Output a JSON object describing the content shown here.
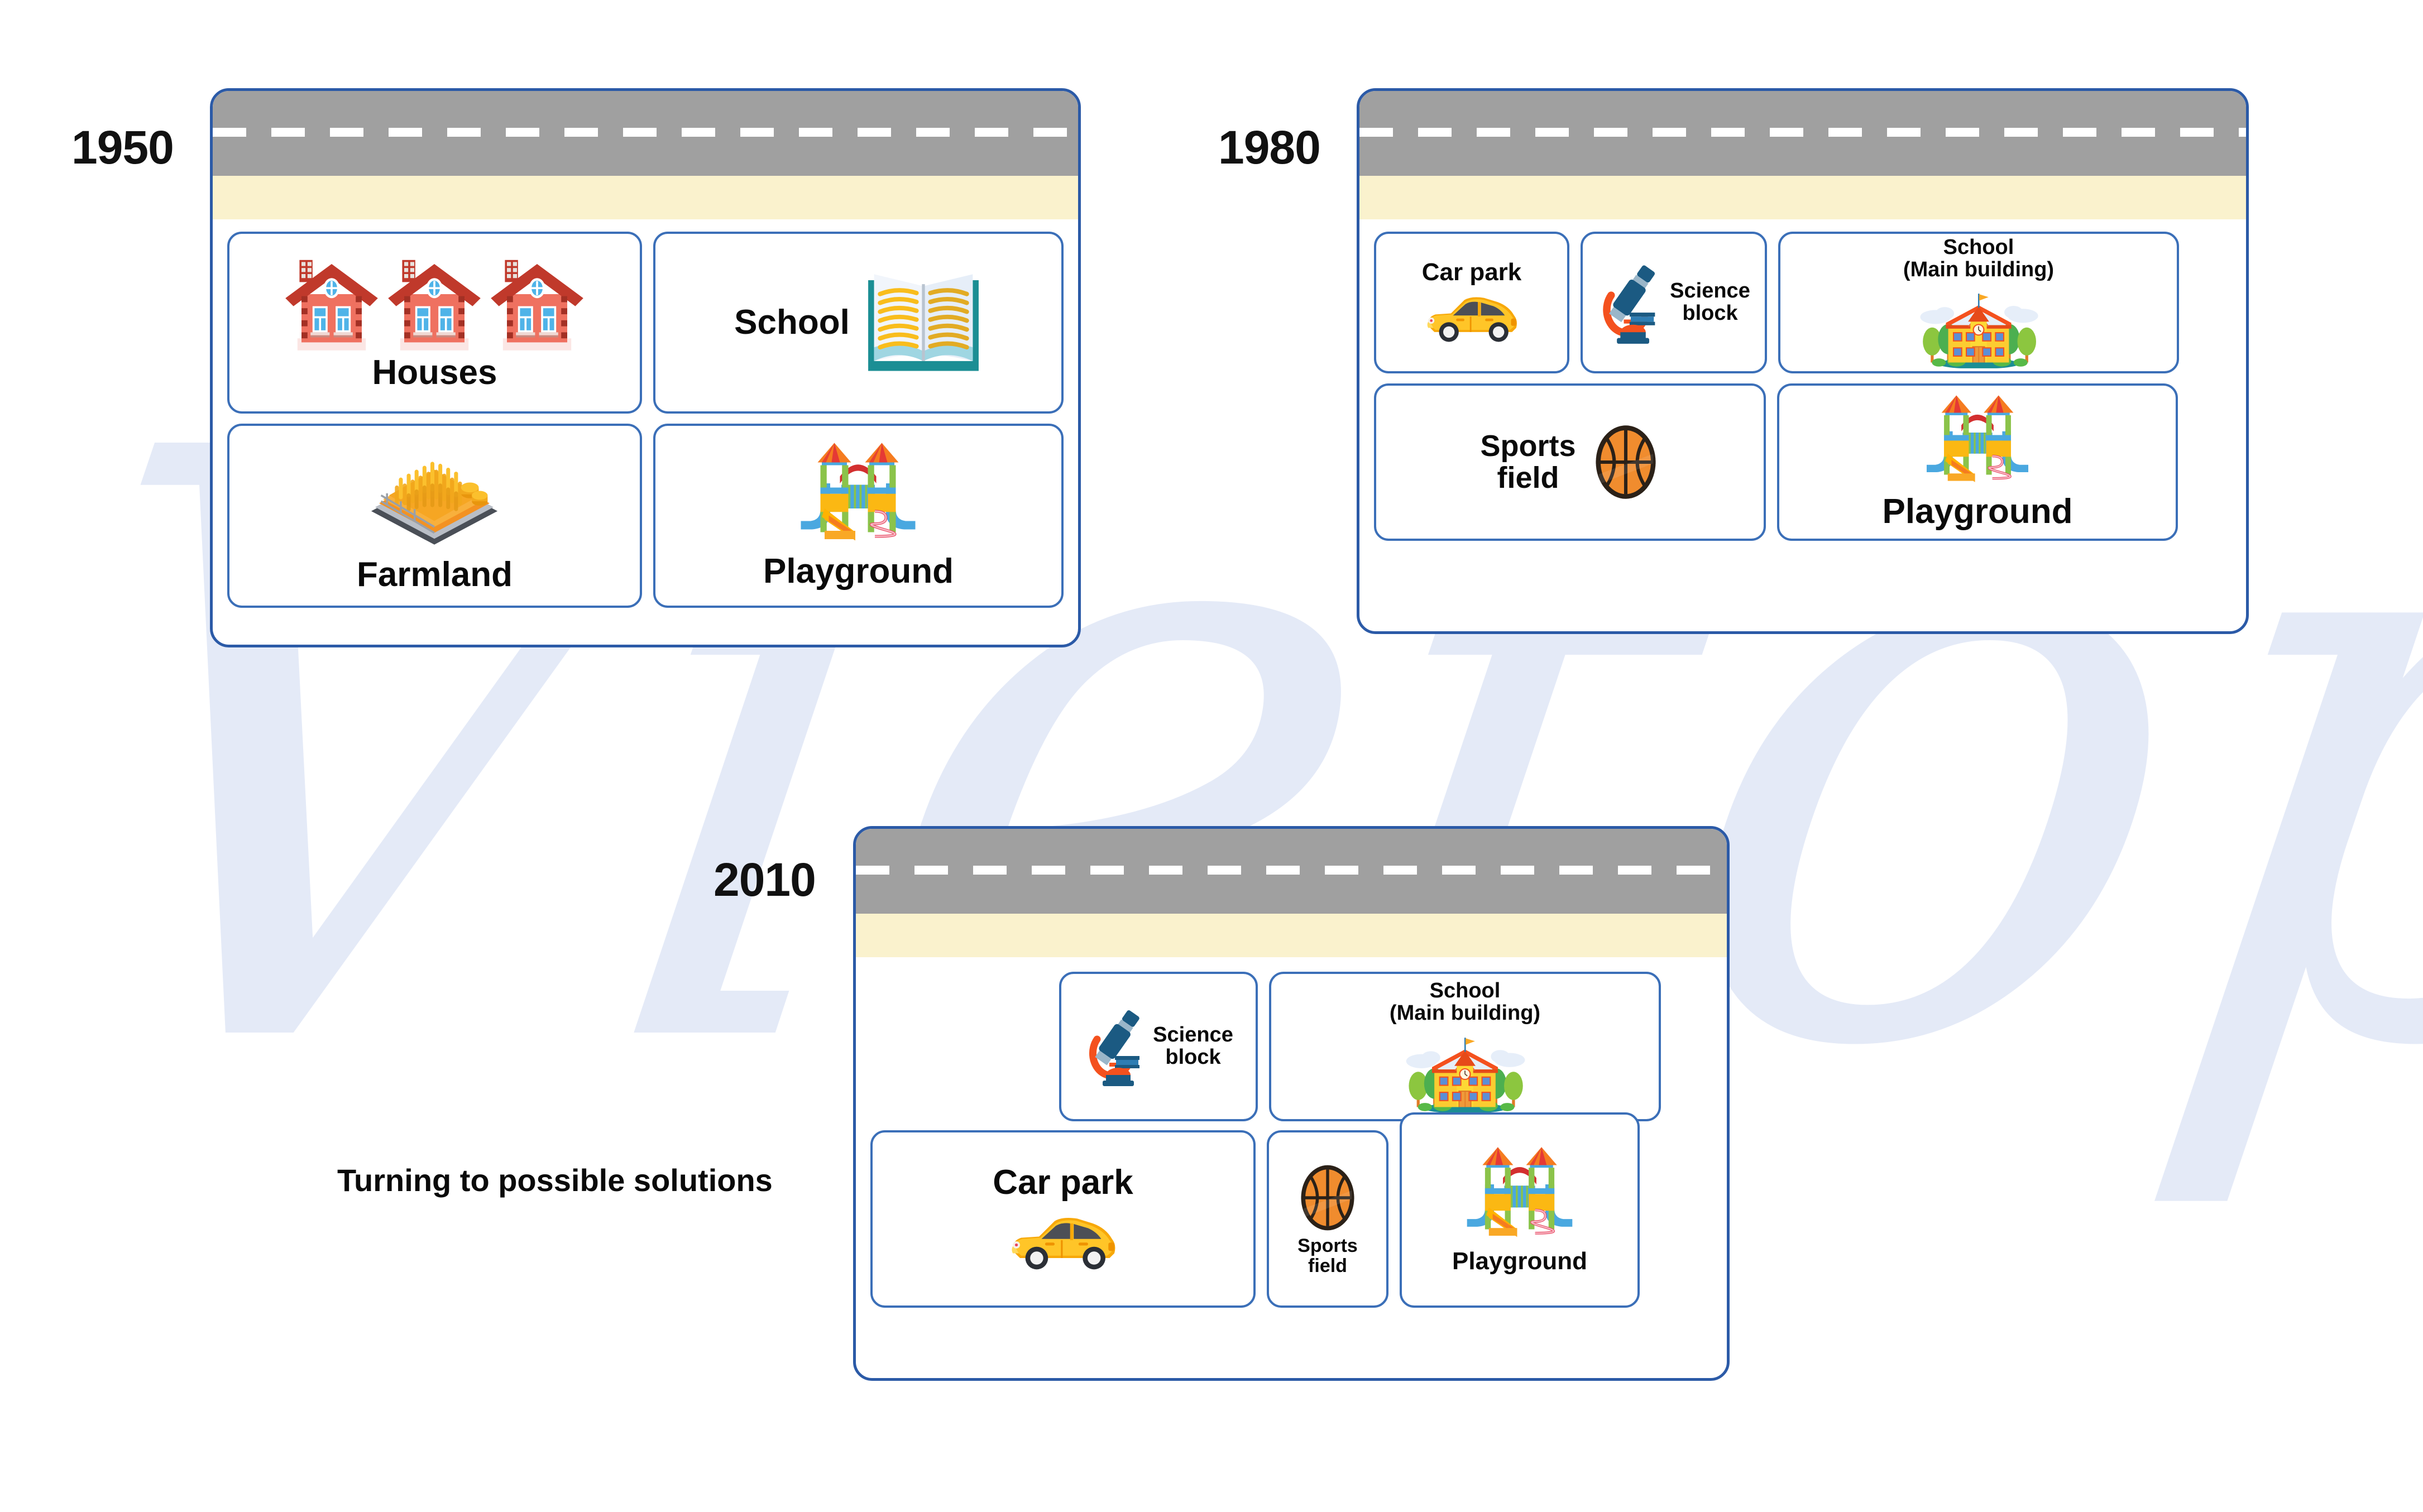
{
  "diagram": {
    "title_note": "Turning to possible solutions",
    "watermark_text": "Vietop",
    "colors": {
      "panel_border": "#2b5aa7",
      "cell_border": "#3b6fb8",
      "road": "#a0a0a0",
      "road_line": "#ffffff",
      "verge": "#faf2cd",
      "watermark": "#e4eaf7",
      "text": "#0a0a0a"
    }
  },
  "panels": [
    {
      "year": "1950",
      "cells": [
        {
          "label": "Houses",
          "icon": "houses-icon"
        },
        {
          "label": "School",
          "icon": "open-book-icon"
        },
        {
          "label": "Farmland",
          "icon": "farmland-icon"
        },
        {
          "label": "Playground",
          "icon": "playground-icon"
        }
      ]
    },
    {
      "year": "1980",
      "cells": [
        {
          "label": "Car park",
          "icon": "yellow-car-icon"
        },
        {
          "label": "Science\nblock",
          "icon": "microscope-icon"
        },
        {
          "label": "School\n(Main building)",
          "icon": "school-building-icon"
        },
        {
          "label": "Sports\nfield",
          "icon": "basketball-icon"
        },
        {
          "label": "Playground",
          "icon": "playground-icon"
        }
      ]
    },
    {
      "year": "2010",
      "cells": [
        {
          "label": "Science\nblock",
          "icon": "microscope-icon"
        },
        {
          "label": "School\n(Main building)",
          "icon": "school-building-icon"
        },
        {
          "label": "Car park",
          "icon": "yellow-car-icon"
        },
        {
          "label": "Sports\nfield",
          "icon": "basketball-icon"
        },
        {
          "label": "Playground",
          "icon": "playground-icon"
        }
      ]
    }
  ]
}
